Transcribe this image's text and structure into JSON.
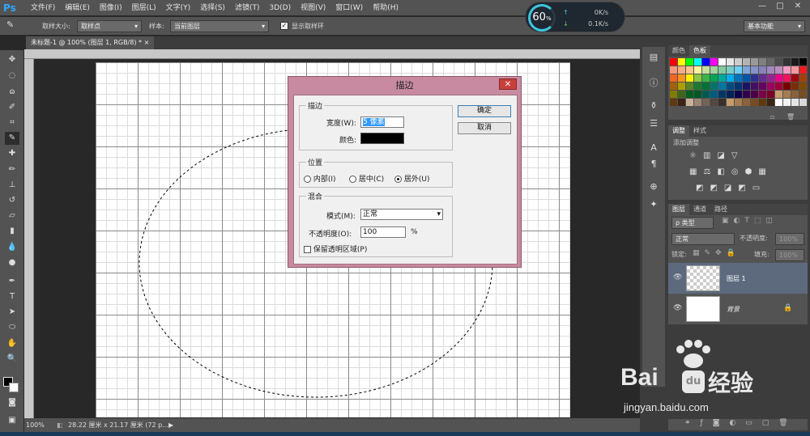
{
  "app": {
    "logo": "Ps"
  },
  "menu": [
    "文件(F)",
    "编辑(E)",
    "图像(I)",
    "图层(L)",
    "文字(Y)",
    "选择(S)",
    "滤镜(T)",
    "3D(D)",
    "视图(V)",
    "窗口(W)",
    "帮助(H)"
  ],
  "window_controls": [
    "—",
    "□",
    "✕"
  ],
  "options": {
    "sample_size_label": "取样大小:",
    "sample_size_value": "取样点",
    "sample_label": "样本:",
    "sample_value": "当前图层",
    "show_ring": "显示取样环",
    "workspace": "基本功能"
  },
  "net_meter": {
    "percent": "60",
    "unit": "%",
    "up": "0K/s",
    "down": "0.1K/s"
  },
  "doc_tab": {
    "title": "未标题-1 @ 100% (图层 1, RGB/8) *",
    "close": "×"
  },
  "status": {
    "zoom": "100%",
    "doc_info": "28.22 厘米 x 21.17 厘米 (72 p..."
  },
  "dialog": {
    "title": "描边",
    "close": "✕",
    "stroke_group": "描边",
    "width_label": "宽度(W):",
    "width_value": "5 像素",
    "color_label": "颜色:",
    "stroke_color": "#000000",
    "position_group": "位置",
    "positions": [
      "内部(I)",
      "居中(C)",
      "居外(U)"
    ],
    "position_selected": 2,
    "blend_group": "混合",
    "mode_label": "模式(M):",
    "mode_value": "正常",
    "opacity_label": "不透明度(O):",
    "opacity_value": "100",
    "opacity_unit": "%",
    "preserve_label": "保留透明区域(P)",
    "ok": "确定",
    "cancel": "取消"
  },
  "panels": {
    "swatch_tabs": [
      "颜色",
      "色板"
    ],
    "adjust_tabs": [
      "调整",
      "样式"
    ],
    "adjust_hint": "添加调整",
    "layer_tabs": [
      "图层",
      "通道",
      "路径"
    ],
    "kind_label": "ρ 类型",
    "blend_mode": "正常",
    "opacity_label": "不透明度:",
    "opacity_value": "100%",
    "lock_label": "锁定:",
    "fill_label": "填充:",
    "fill_value": "100%",
    "layers": [
      {
        "name": "图层 1",
        "selected": true
      },
      {
        "name": "背景",
        "selected": false,
        "locked": true
      }
    ]
  },
  "watermark": {
    "brand": "Bai",
    "brand_cn": "经验",
    "paw": "du",
    "url": "jingyan.baidu.com"
  }
}
